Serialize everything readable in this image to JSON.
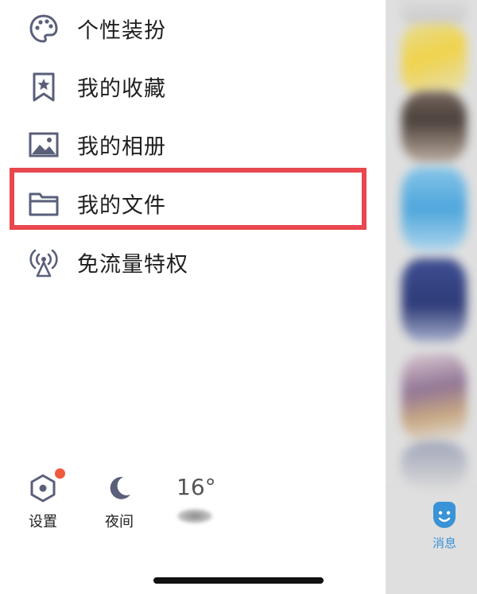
{
  "menu": {
    "items": [
      {
        "label": "个性装扮",
        "icon": "palette-icon"
      },
      {
        "label": "我的收藏",
        "icon": "bookmark-star-icon"
      },
      {
        "label": "我的相册",
        "icon": "image-icon"
      },
      {
        "label": "我的文件",
        "icon": "folder-icon",
        "highlighted": true
      },
      {
        "label": "免流量特权",
        "icon": "signal-tower-icon"
      }
    ]
  },
  "bottom_bar": {
    "settings_label": "设置",
    "night_label": "夜间",
    "temperature": "16°",
    "settings_has_badge": true
  },
  "side_panel": {
    "tab_label": "消息"
  },
  "colors": {
    "highlight_border": "#e8474e",
    "badge": "#f05a3c",
    "icon": "#5a5f7a",
    "tab_active": "#3a93d6"
  }
}
